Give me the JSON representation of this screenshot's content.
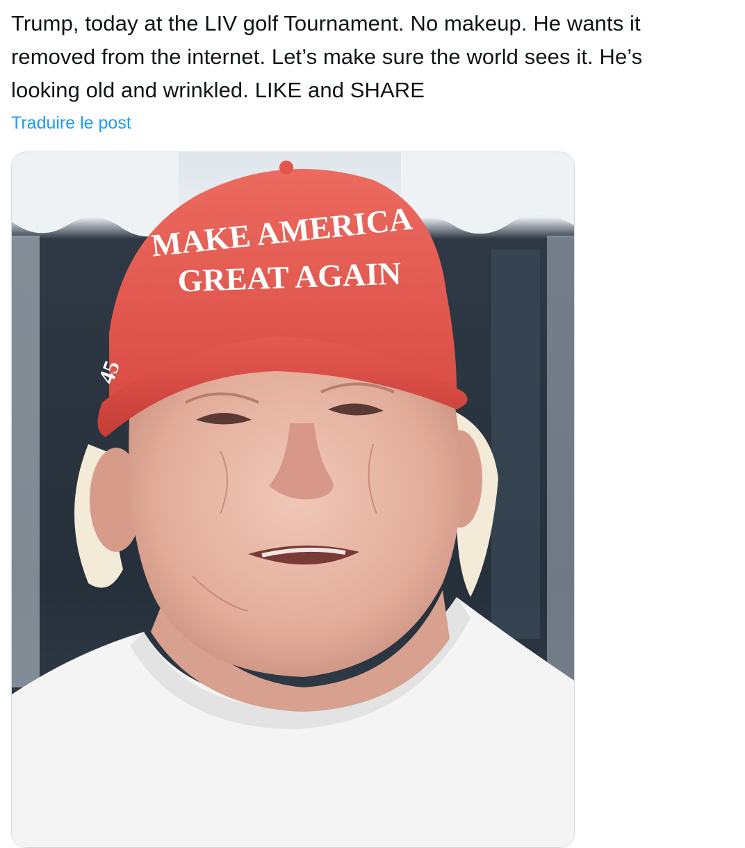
{
  "tweet": {
    "text_lines": [
      "Trump, today at the LIV golf Tournament. No makeup. He wants it",
      "removed from the internet. Let’s make sure the world sees it. He’s",
      "looking old and wrinkled. LIKE and SHARE"
    ],
    "translate_label": "Traduire le post"
  },
  "media": {
    "hat_line1": "MAKE AMERICA",
    "hat_line2": "GREAT AGAIN",
    "hat_side": "45",
    "colors": {
      "hat_red": "#e5534b",
      "skin": "#e7b8a6",
      "hair": "#f3ead7",
      "background_dark": "#2a3440",
      "shirt": "#f4f4f4"
    }
  },
  "colors": {
    "text": "#0f1419",
    "link": "#1d9bf0",
    "border": "#cfd9de"
  }
}
